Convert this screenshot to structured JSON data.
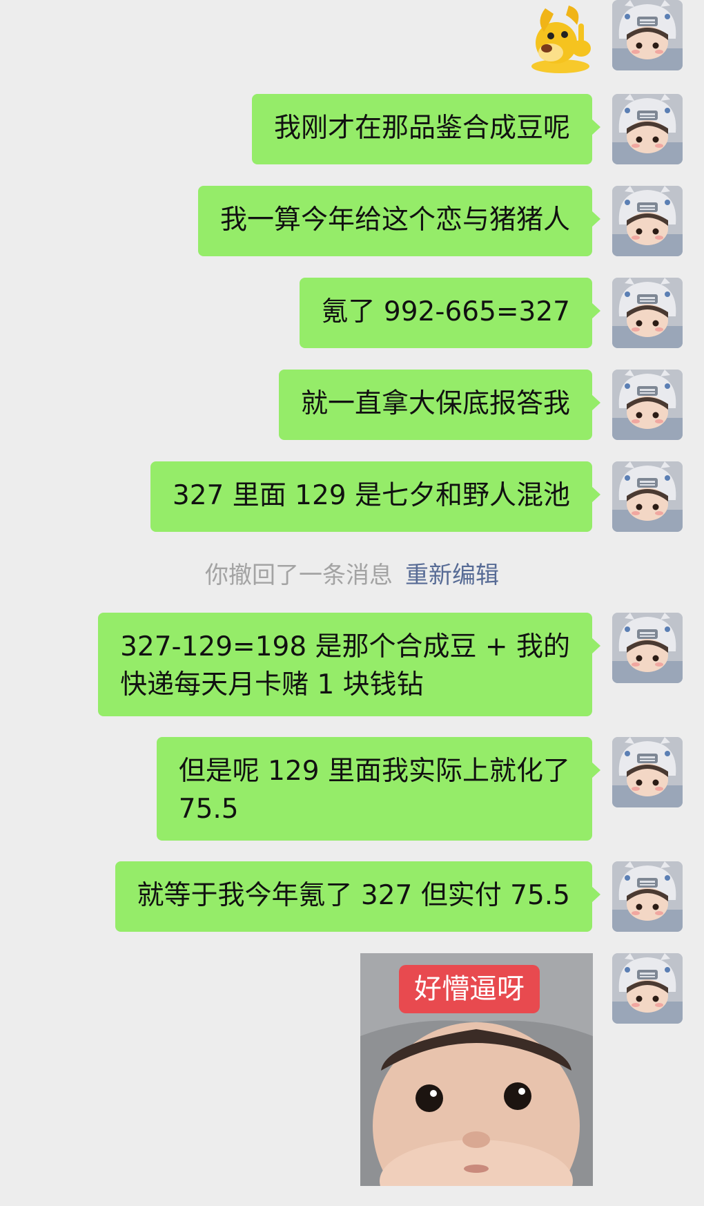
{
  "messages": [
    {
      "text": "我刚才在那品鉴合成豆呢"
    },
    {
      "text": "我一算今年给这个恋与猪猪人"
    },
    {
      "text": "氪了 992-665=327"
    },
    {
      "text": "就一直拿大保底报答我"
    },
    {
      "text": "327 里面 129 是七夕和野人混池"
    },
    {
      "lines": [
        "327-129=198 是那个合成豆 + 我的",
        "快递每天月卡赌 1 块钱钻"
      ]
    },
    {
      "lines": [
        "但是呢 129 里面我实际上就化了",
        "75.5"
      ]
    },
    {
      "text": "就等于我今年氪了 327 但实付 75.5"
    }
  ],
  "system_notice": {
    "text": "你撤回了一条消息",
    "action": "重新编辑"
  },
  "sticker_top": {
    "icon": "yellow-dog-sticker-icon"
  },
  "sticker_bottom": {
    "caption": "好懵逼呀"
  },
  "colors": {
    "bubble": "#95ec69",
    "background": "#ededed",
    "link": "#576b95",
    "caption_bg": "#e84a4f"
  }
}
